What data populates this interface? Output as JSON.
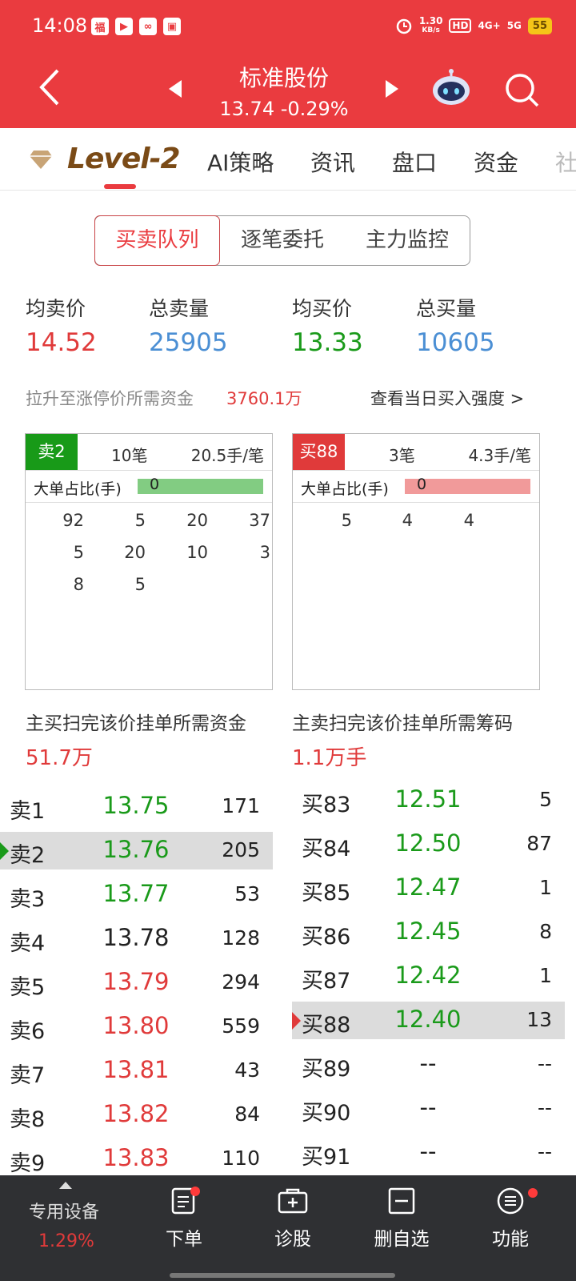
{
  "status": {
    "time": "14:08",
    "network_speed_top": "1.30",
    "network_speed_bottom": "KB/s",
    "hd": "HD",
    "signal1": "4G+",
    "signal2": "5G",
    "battery": "55"
  },
  "header": {
    "stock_name": "标准股份",
    "price_line": "13.74  -0.29%"
  },
  "tabs": {
    "level2": "Level-2",
    "items": [
      "AI策略",
      "资讯",
      "盘口",
      "资金"
    ],
    "more": "社区"
  },
  "segments": [
    "买卖队列",
    "逐笔委托",
    "主力监控"
  ],
  "summary": {
    "avg_sell_label": "均卖价",
    "avg_sell": "14.52",
    "total_sell_label": "总卖量",
    "total_sell": "25905",
    "avg_buy_label": "均买价",
    "avg_buy": "13.33",
    "total_buy_label": "总买量",
    "total_buy": "10605",
    "fund_label": "拉升至涨停价所需资金",
    "fund_value": "3760.1万",
    "strength_link": "查看当日买入强度 >"
  },
  "queue_sell": {
    "tag": "卖2",
    "count": "10笔",
    "per": "20.5手/笔",
    "ratio_label": "大单占比(手)",
    "ratio_value": "0",
    "cells": [
      [
        "92",
        "5",
        "20",
        "37"
      ],
      [
        "5",
        "20",
        "10",
        "3"
      ],
      [
        "8",
        "5"
      ]
    ]
  },
  "queue_buy": {
    "tag": "买88",
    "count": "3笔",
    "per": "4.3手/笔",
    "ratio_label": "大单占比(手)",
    "ratio_value": "0",
    "cells": [
      [
        "5",
        "4",
        "4"
      ]
    ]
  },
  "needs": {
    "buy_label": "主买扫完该价挂单所需资金",
    "buy_value": "51.7万",
    "sell_label": "主卖扫完该价挂单所需筹码",
    "sell_value": "1.1万手"
  },
  "sell_book": [
    {
      "label": "卖1",
      "price": "13.75",
      "vol": "171",
      "color": "green"
    },
    {
      "label": "卖2",
      "price": "13.76",
      "vol": "205",
      "color": "green",
      "highlight": true
    },
    {
      "label": "卖3",
      "price": "13.77",
      "vol": "53",
      "color": "green"
    },
    {
      "label": "卖4",
      "price": "13.78",
      "vol": "128",
      "color": "black"
    },
    {
      "label": "卖5",
      "price": "13.79",
      "vol": "294",
      "color": "red"
    },
    {
      "label": "卖6",
      "price": "13.80",
      "vol": "559",
      "color": "red"
    },
    {
      "label": "卖7",
      "price": "13.81",
      "vol": "43",
      "color": "red"
    },
    {
      "label": "卖8",
      "price": "13.82",
      "vol": "84",
      "color": "red"
    },
    {
      "label": "卖9",
      "price": "13.83",
      "vol": "110",
      "color": "red"
    }
  ],
  "buy_book": [
    {
      "label": "买83",
      "price": "12.51",
      "vol": "5",
      "color": "green"
    },
    {
      "label": "买84",
      "price": "12.50",
      "vol": "87",
      "color": "green"
    },
    {
      "label": "买85",
      "price": "12.47",
      "vol": "1",
      "color": "green"
    },
    {
      "label": "买86",
      "price": "12.45",
      "vol": "8",
      "color": "green"
    },
    {
      "label": "买87",
      "price": "12.42",
      "vol": "1",
      "color": "green"
    },
    {
      "label": "买88",
      "price": "12.40",
      "vol": "13",
      "color": "green",
      "highlight": true
    },
    {
      "label": "买89",
      "price": "--",
      "vol": "--",
      "color": "black"
    },
    {
      "label": "买90",
      "price": "--",
      "vol": "--",
      "color": "black"
    },
    {
      "label": "买91",
      "price": "--",
      "vol": "--",
      "color": "black"
    }
  ],
  "bottom": {
    "device_label": "专用设备",
    "device_value": "1.29%",
    "order": "下单",
    "diagnose": "诊股",
    "remove_watch": "删自选",
    "functions": "功能"
  },
  "colors": {
    "header_red": "#ea3b3f",
    "price_red": "#e03a3a",
    "price_green": "#1a9a1a",
    "volume_blue": "#4b8fd4",
    "level2_brown": "#7a4a16"
  }
}
